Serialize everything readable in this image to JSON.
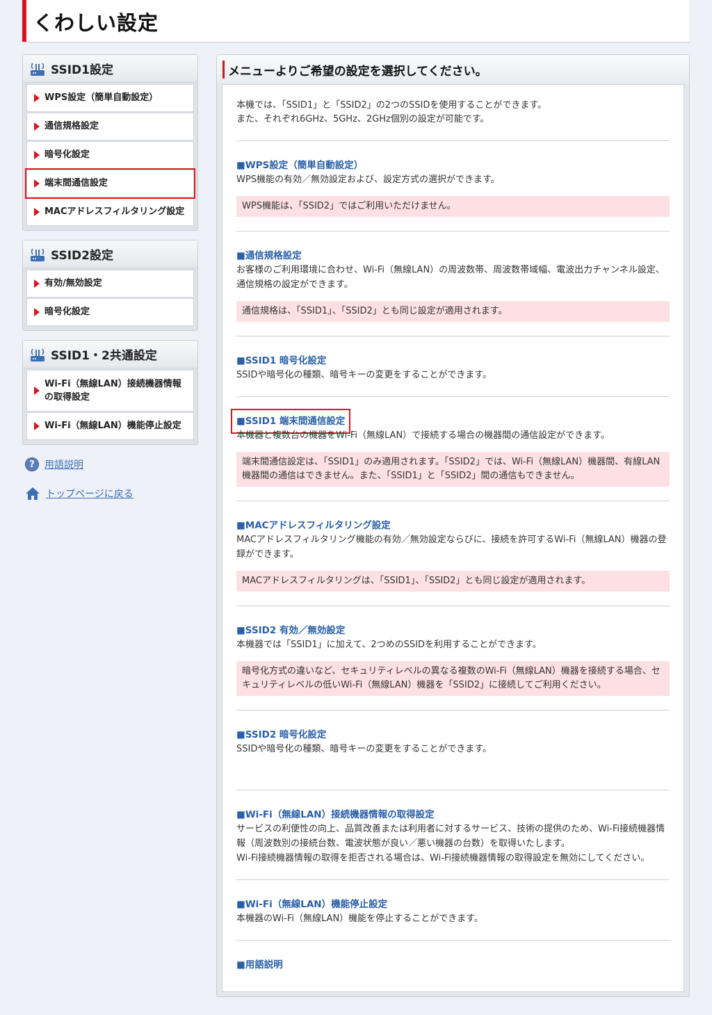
{
  "header": {
    "title": "くわしい設定"
  },
  "sidebar": {
    "groups": [
      {
        "title": "SSID1設定",
        "items": [
          {
            "label": "WPS設定（簡単自動設定）"
          },
          {
            "label": "通信規格設定"
          },
          {
            "label": "暗号化設定"
          },
          {
            "label": "端末間通信設定"
          },
          {
            "label": "MACアドレスフィルタリング設定"
          }
        ]
      },
      {
        "title": "SSID2設定",
        "items": [
          {
            "label": "有効/無効設定"
          },
          {
            "label": "暗号化設定"
          }
        ]
      },
      {
        "title": "SSID1・2共通設定",
        "items": [
          {
            "label": "Wi-Fi（無線LAN）接続機器情報の取得設定"
          },
          {
            "label": "Wi-Fi（無線LAN）機能停止設定"
          }
        ]
      }
    ],
    "links": {
      "glossary": "用語説明",
      "top": "トップページに戻る"
    }
  },
  "main": {
    "heading": "メニューよりご希望の設定を選択してください。",
    "intro": [
      "本機では、「SSID1」と「SSID2」の2つのSSIDを使用することができます。",
      "また、それぞれ6GHz、5GHz、2GHz個別の設定が可能です。"
    ],
    "sections": [
      {
        "title": "■WPS設定（簡単自動設定）",
        "desc": "WPS機能の有効／無効設定および、設定方式の選択ができます。",
        "note": "WPS機能は、「SSID2」ではご利用いただけません。"
      },
      {
        "title": "■通信規格設定",
        "desc": "お客様のご利用環境に合わせ、Wi-Fi（無線LAN）の周波数帯、周波数帯域幅、電波出力チャンネル設定、通信規格の設定ができます。",
        "note": "通信規格は、「SSID1」、「SSID2」とも同じ設定が適用されます。"
      },
      {
        "title": "■SSID1 暗号化設定",
        "desc": "SSIDや暗号化の種類、暗号キーの変更をすることができます。",
        "note": ""
      },
      {
        "title": "■SSID1 端末間通信設定",
        "desc": "本機器と複数台の機器をWi-Fi（無線LAN）で接続する場合の機器間の通信設定ができます。",
        "note": "端末間通信設定は、「SSID1」のみ適用されます。「SSID2」では、Wi-Fi（無線LAN）機器間、有線LAN機器間の通信はできません。また、「SSID1」と「SSID2」間の通信もできません。"
      },
      {
        "title": "■MACアドレスフィルタリング設定",
        "desc": "MACアドレスフィルタリング機能の有効／無効設定ならびに、接続を許可するWi-Fi（無線LAN）機器の登録ができます。",
        "note": "MACアドレスフィルタリングは、「SSID1」、「SSID2」とも同じ設定が適用されます。"
      },
      {
        "title": "■SSID2 有効／無効設定",
        "desc": "本機器では「SSID1」に加えて、2つめのSSIDを利用することができます。",
        "note": "暗号化方式の違いなど、セキュリティレベルの異なる複数のWi-Fi（無線LAN）機器を接続する場合、セキュリティレベルの低いWi-Fi（無線LAN）機器を「SSID2」に接続してご利用ください。"
      },
      {
        "title": "■SSID2 暗号化設定",
        "desc": "SSIDや暗号化の種類、暗号キーの変更をすることができます。",
        "note": ""
      },
      {
        "title": "■Wi-Fi（無線LAN）接続機器情報の取得設定",
        "desc": "サービスの利便性の向上、品質改善または利用者に対するサービス、技術の提供のため、Wi-Fi接続機器情報（周波数別の接続台数、電波状態が良い／悪い機器の台数）を取得いたします。",
        "desc2": "Wi-Fi接続機器情報の取得を拒否される場合は、Wi-Fi接続機器情報の取得設定を無効にしてください。",
        "note": ""
      },
      {
        "title": "■Wi-Fi（無線LAN）機能停止設定",
        "desc": "本機器のWi-Fi（無線LAN）機能を停止することができます。",
        "note": ""
      },
      {
        "title": "■用語説明",
        "desc": "",
        "note": ""
      }
    ]
  },
  "colors": {
    "accent": "#d9141e",
    "link": "#2960a8",
    "note_bg": "#fde0e3"
  }
}
